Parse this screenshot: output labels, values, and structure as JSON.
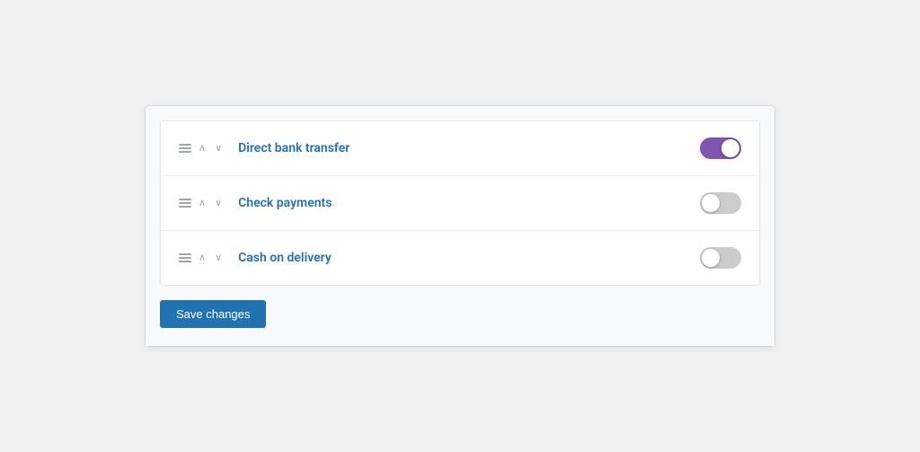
{
  "panel": {
    "rows": [
      {
        "id": "direct-bank-transfer",
        "name": "Direct bank transfer",
        "enabled": true
      },
      {
        "id": "check-payments",
        "name": "Check payments",
        "enabled": false
      },
      {
        "id": "cash-on-delivery",
        "name": "Cash on delivery",
        "enabled": false
      }
    ]
  },
  "footer": {
    "save_label": "Save changes"
  },
  "icons": {
    "up_arrow": "∧",
    "down_arrow": "∨"
  }
}
